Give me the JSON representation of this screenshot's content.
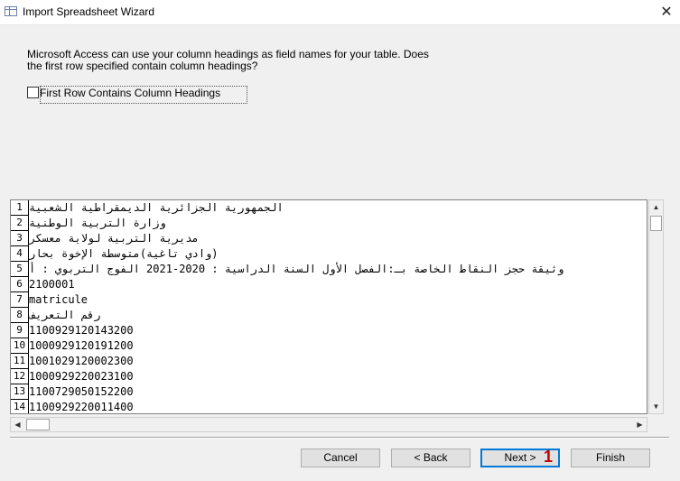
{
  "window": {
    "title": "Import Spreadsheet Wizard",
    "close_glyph": "✕"
  },
  "description": "Microsoft Access can use your column headings as field names for your table. Does the first row specified contain column headings?",
  "checkbox": {
    "label": "First Row Contains Column Headings",
    "checked": false
  },
  "preview": {
    "rows": [
      {
        "num": "1",
        "text": "الجمهورية الجزائرية الديمقراطية الشعبية",
        "rtl": true
      },
      {
        "num": "2",
        "text": "وزارة التربية الوطنية",
        "rtl": true
      },
      {
        "num": "3",
        "text": "مديرية التربية لولاية معسكر",
        "rtl": true
      },
      {
        "num": "4",
        "text": "(وادي تاغية)متوسطة الإخوة بحار",
        "rtl": true
      },
      {
        "num": "5",
        "text": "وثيقة حجز النقاط  الخاصة بـ:الفصل الأول السنة الدراسية : 2020-2021  الفوج التربوي : أ",
        "rtl": true
      },
      {
        "num": "6",
        "text": "2100001",
        "rtl": false
      },
      {
        "num": "7",
        "text": "matricule",
        "rtl": false
      },
      {
        "num": "8",
        "text": "رقم التعريف",
        "rtl": true
      },
      {
        "num": "9",
        "text": "1100929120143200",
        "rtl": false
      },
      {
        "num": "10",
        "text": "1000929120191200",
        "rtl": false
      },
      {
        "num": "11",
        "text": "1001029120002300",
        "rtl": false
      },
      {
        "num": "12",
        "text": "1000929220023100",
        "rtl": false
      },
      {
        "num": "13",
        "text": "1100729050152200",
        "rtl": false
      },
      {
        "num": "14",
        "text": "1100929220011400",
        "rtl": false
      }
    ]
  },
  "buttons": {
    "cancel": "Cancel",
    "back": "< Back",
    "next": "Next >",
    "finish": "Finish"
  },
  "annotation_badge": "1",
  "scroll_glyphs": {
    "up": "▲",
    "down": "▼",
    "left": "◀",
    "right": "▶"
  }
}
